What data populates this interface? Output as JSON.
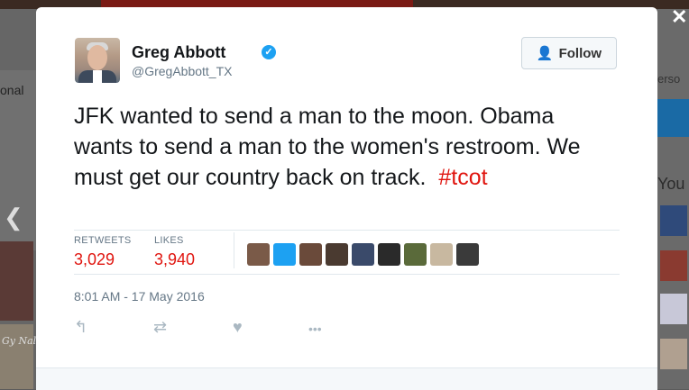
{
  "background": {
    "left_text": "onal",
    "right_text": "erso",
    "right_heading": "You",
    "left_cursive": "Gy Nales"
  },
  "lightbox": {
    "close_glyph": "✕",
    "prev_glyph": "❮"
  },
  "tweet": {
    "author_name": "Greg Abbott",
    "handle": "@GregAbbott_TX",
    "follow_label": "Follow",
    "text": "JFK wanted to send a man to the moon. Obama wants to send a man to the women's restroom. We must get our country back on track.",
    "hashtag": "#tcot",
    "retweets_label": "RETWEETS",
    "retweets_count": "3,029",
    "likes_label": "LIKES",
    "likes_count": "3,940",
    "timestamp": "8:01 AM - 17 May 2016",
    "liker_avatars": [
      "#7a5a48",
      "#1da1f2",
      "#6a4a3a",
      "#4a3a30",
      "#3a4a6a",
      "#2a2a2a",
      "#5a6a3a",
      "#c8b8a0",
      "#3a3a3a"
    ],
    "actions": [
      {
        "name": "reply-icon",
        "glyph": "↰"
      },
      {
        "name": "retweet-icon",
        "glyph": "⇄"
      },
      {
        "name": "like-icon",
        "glyph": "♥"
      },
      {
        "name": "more-icon",
        "glyph": "•••"
      }
    ]
  },
  "colors": {
    "accent": "#1da1f2",
    "stat_red": "#e0150f",
    "hashtag_red": "#e0150f"
  }
}
